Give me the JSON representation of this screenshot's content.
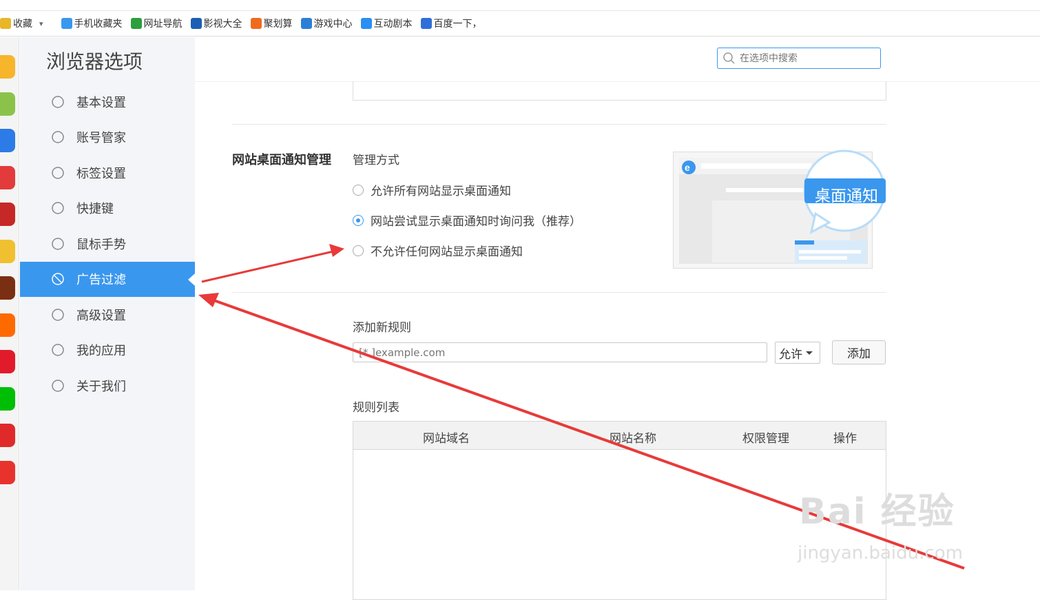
{
  "bookmarks": [
    {
      "label": "收藏",
      "icon": "favorites-icon",
      "color": "#e9b62a"
    },
    {
      "label": "手机收藏夹",
      "icon": "mobile-favorites-icon",
      "color": "#3a97ee"
    },
    {
      "label": "网址导航",
      "icon": "nav-2345-icon",
      "color": "#2e9e3e"
    },
    {
      "label": "影视大全",
      "icon": "video-icon",
      "color": "#1b5fb5"
    },
    {
      "label": "聚划算",
      "icon": "juhuasuan-icon",
      "color": "#f06a1e"
    },
    {
      "label": "游戏中心",
      "icon": "game-center-icon",
      "color": "#2b7fd6"
    },
    {
      "label": "互动剧本",
      "icon": "interactive-script-icon",
      "color": "#2b8ef2"
    },
    {
      "label": "百度一下，",
      "icon": "baidu-icon",
      "color": "#2f6fd8"
    }
  ],
  "dock_apps": [
    {
      "name": "favorites-app-icon",
      "color": "#f7b52b"
    },
    {
      "name": "line-app-icon",
      "color": "#8bc34a"
    },
    {
      "name": "doc-app-icon",
      "color": "#2d7be6"
    },
    {
      "name": "weibo-app-icon",
      "color": "#e33b3b"
    },
    {
      "name": "flash-app-icon",
      "color": "#c62828"
    },
    {
      "name": "weather-app-icon",
      "color": "#f0c030"
    },
    {
      "name": "game-app-icon",
      "color": "#7a2f12"
    },
    {
      "name": "taobao-app-icon",
      "color": "#ff6a00"
    },
    {
      "name": "tmall-app-icon",
      "color": "#e21b2b"
    },
    {
      "name": "iqiyi-app-icon",
      "color": "#00be06"
    },
    {
      "name": "dangdang-app-icon",
      "color": "#e02a2a"
    },
    {
      "name": "toutiao-app-icon",
      "color": "#e8332d"
    }
  ],
  "sidebar": {
    "title": "浏览器选项",
    "items": [
      {
        "label": "基本设置",
        "icon": "gear-icon",
        "active": false
      },
      {
        "label": "账号管家",
        "icon": "lock-icon",
        "active": false
      },
      {
        "label": "标签设置",
        "icon": "tabs-icon",
        "active": false
      },
      {
        "label": "快捷键",
        "icon": "shortcut-icon",
        "active": false
      },
      {
        "label": "鼠标手势",
        "icon": "mouse-icon",
        "active": false
      },
      {
        "label": "广告过滤",
        "icon": "block-icon",
        "active": true
      },
      {
        "label": "高级设置",
        "icon": "wrench-icon",
        "active": false
      },
      {
        "label": "我的应用",
        "icon": "apps-icon",
        "active": false
      },
      {
        "label": "关于我们",
        "icon": "info-icon",
        "active": false
      }
    ]
  },
  "search": {
    "placeholder": "在选项中搜索"
  },
  "notification": {
    "section_title": "网站桌面通知管理",
    "mode_label": "管理方式",
    "options": [
      {
        "label": "允许所有网站显示桌面通知",
        "checked": false
      },
      {
        "label": "网站尝试显示桌面通知时询问我（推荐）",
        "checked": true
      },
      {
        "label": "不允许任何网站显示桌面通知",
        "checked": false
      }
    ],
    "preview_badge": "桌面通知"
  },
  "rules": {
    "add_label": "添加新规则",
    "input_placeholder": "[*.]example.com",
    "permission_value": "允许",
    "add_button": "添加",
    "list_label": "规则列表",
    "columns": [
      "网站域名",
      "网站名称",
      "权限管理",
      "操作"
    ]
  },
  "colors": {
    "accent": "#3a97ee",
    "annotation_arrow": "#e83a3a"
  },
  "watermark": {
    "brand": "Bai 经验",
    "url": "jingyan.baidu.com"
  }
}
